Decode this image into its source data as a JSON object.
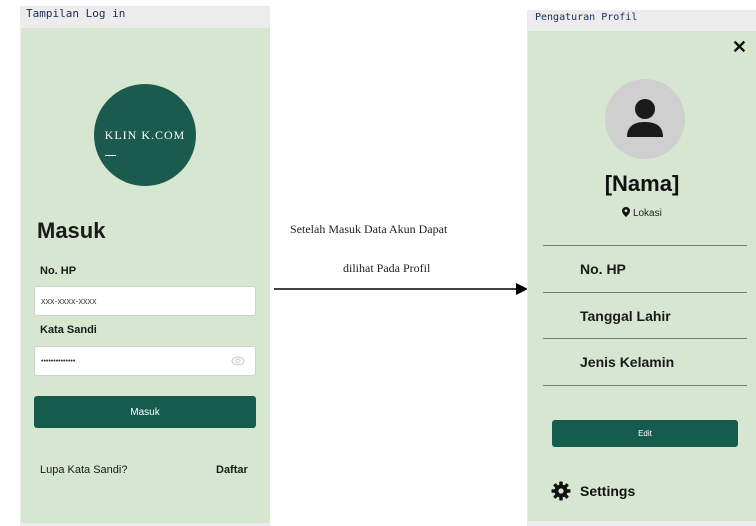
{
  "left_screen": {
    "frame_label": "Tampilan Log in",
    "logo_text": "KLIN K.COM",
    "heading": "Masuk",
    "phone_label": "No. HP",
    "phone_placeholder": "xxx-xxxx-xxxx",
    "password_label": "Kata Sandi",
    "password_value": "••••••••••••••",
    "login_button": "Masuk",
    "forgot_link": "Lupa Kata Sandi?",
    "register_link": "Daftar"
  },
  "caption": {
    "line1": "Setelah Masuk Data Akun  Dapat",
    "line2": "dilihat Pada Profil"
  },
  "right_screen": {
    "frame_label": "Pengaturan Profil",
    "close_label": "✕",
    "name": "[Nama]",
    "location": "Lokasi",
    "items": [
      "No. HP",
      "Tanggal Lahir",
      "Jenis Kelamin"
    ],
    "edit_button": "Edit",
    "settings_label": "Settings"
  },
  "colors": {
    "screen_bg": "#d6e6d0",
    "brand": "#165c4e"
  }
}
